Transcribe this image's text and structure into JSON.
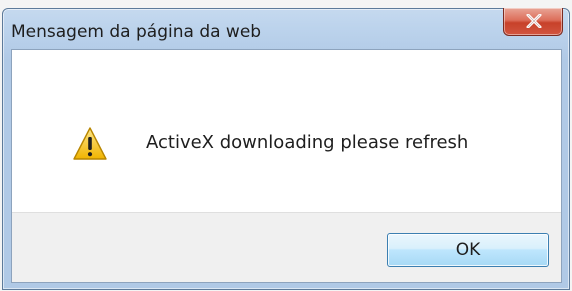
{
  "dialog": {
    "title": "Mensagem da página da web",
    "message": "ActiveX downloading please refresh",
    "ok_label": "OK",
    "icon": "warning-icon",
    "close_icon": "close-icon"
  },
  "colors": {
    "frame": "#bcd3ec",
    "close_button": "#c7412a",
    "ok_button": "#bee6fd",
    "ok_border": "#3c7fb1",
    "footer": "#f0f0f0",
    "warning_fill": "#f5c518"
  }
}
